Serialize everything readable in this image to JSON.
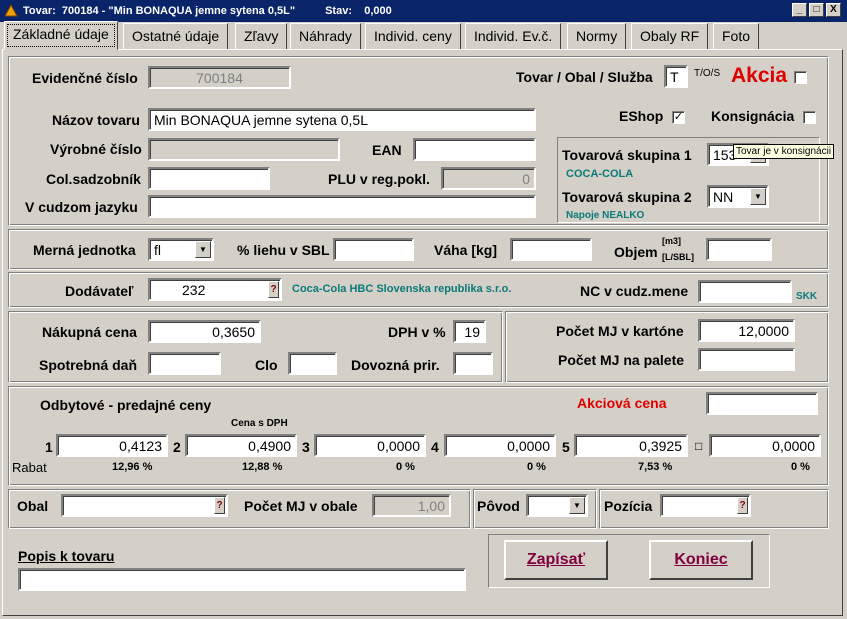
{
  "window": {
    "title": "Tovar:  700184 - \"Min BONAQUA jemne sytena 0,5L\"",
    "state": "Stav:    0,000",
    "buttons": [
      "_",
      "□",
      "X"
    ]
  },
  "tabs": [
    "Základné údaje",
    "Ostatné údaje",
    "Zľavy",
    "Náhrady",
    "Individ. ceny",
    "Individ. Ev.č.",
    "Normy",
    "Obaly RF",
    "Foto"
  ],
  "general": {
    "evid_label": "Evidenčné číslo",
    "evid_value": "700184",
    "type_label": "Tovar / Obal / Služba",
    "type_value": "T",
    "type_hint": "T/O/S",
    "akcia_label": "Akcia",
    "name_label": "Názov tovaru",
    "name_value": "Min BONAQUA jemne sytena 0,5L",
    "eshop_label": "EShop",
    "eshop_checked": "✓",
    "konsig_label": "Konsignácia",
    "vyrob_label": "Výrobné číslo",
    "ean_label": "EAN",
    "col_label": "Col.sadzobník",
    "plu_label": "PLU v reg.pokl.",
    "plu_value": "0",
    "foreign_label": "V cudzom jazyku",
    "group1_label": "Tovarová skupina 1",
    "group1_value": "153",
    "group1_name": "COCA-COLA",
    "group2_label": "Tovarová skupina 2",
    "group2_value": "NN",
    "group2_name": "Napoje NEALKO",
    "tooltip": "Tovar je v konsignácii"
  },
  "units": {
    "unit_label": "Merná jednotka",
    "unit_value": "fl",
    "alcohol_label": "% liehu v SBL",
    "weight_label": "Váha [kg]",
    "volume_label": "Objem",
    "volume_unit_top": "[m3]",
    "volume_unit_bottom": "[L/SBL]"
  },
  "supplier": {
    "label": "Dodávateľ",
    "code": "232",
    "name": "Coca-Cola HBC Slovenska republika s.r.o.",
    "nc_label": "NC v cudz.mene",
    "currency": "SKK"
  },
  "purchase": {
    "price_label": "Nákupná cena",
    "price_value": "0,3650",
    "dph_label": "DPH v %",
    "dph_value": "19",
    "excise_label": "Spotrebná daň",
    "clo_label": "Clo",
    "import_label": "Dovozná prir.",
    "carton_label": "Počet MJ v kartóne",
    "carton_value": "12,0000",
    "pallet_label": "Počet MJ na palete"
  },
  "prices": {
    "title": "Odbytové - predajné ceny",
    "akciova_label": "Akciová cena",
    "dph_note": "Cena s DPH",
    "rabat_label": "Rabat",
    "items": [
      {
        "num": "1",
        "value": "0,4123",
        "rabat": "12,96 %"
      },
      {
        "num": "2",
        "value": "0,4900",
        "rabat": "12,88 %"
      },
      {
        "num": "3",
        "value": "0,0000",
        "rabat": "0 %"
      },
      {
        "num": "4",
        "value": "0,0000",
        "rabat": "0 %"
      },
      {
        "num": "5",
        "value": "0,3925",
        "rabat": "7,53 %"
      },
      {
        "num": "□",
        "value": "0,0000",
        "rabat": "0 %"
      }
    ]
  },
  "bottom": {
    "obal_label": "Obal",
    "obal_count_label": "Počet MJ v obale",
    "obal_count_value": "1,00",
    "povod_label": "Pôvod",
    "pozicia_label": "Pozícia",
    "popis_label": "Popis k tovaru",
    "save_label": "Zapísať",
    "end_label": "Koniec"
  },
  "icons": {
    "app": "app-icon",
    "help": "?"
  }
}
